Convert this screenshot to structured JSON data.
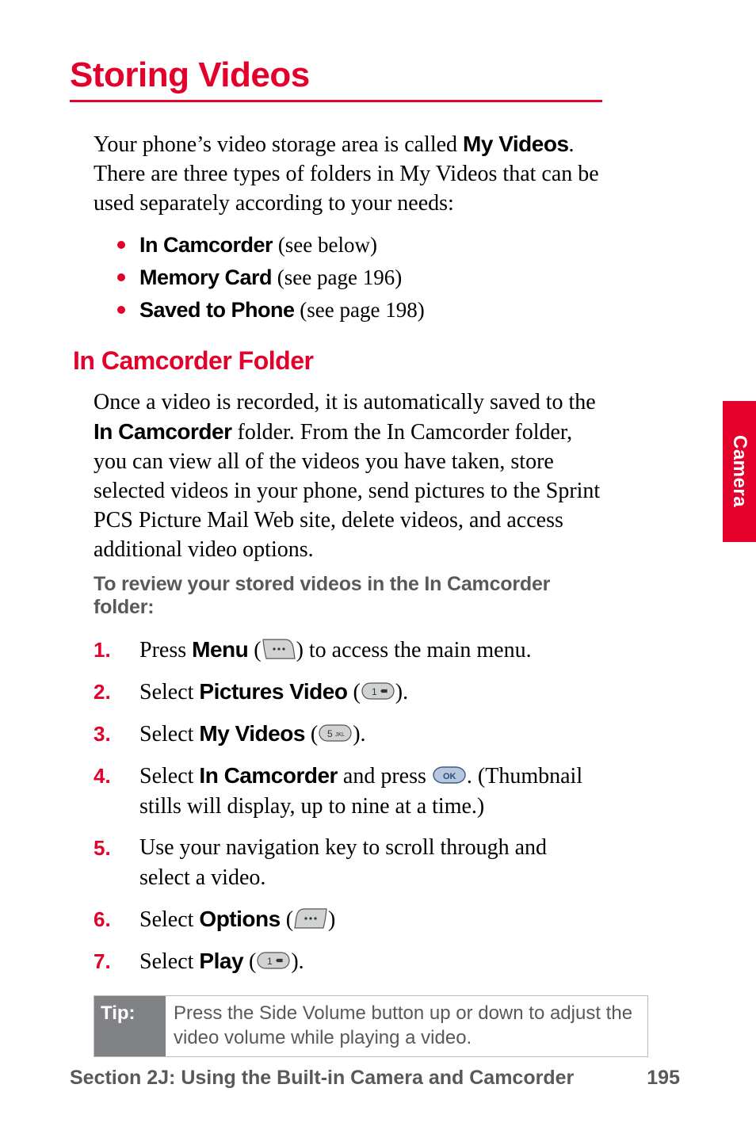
{
  "title": "Storing Videos",
  "intro": {
    "pre": "Your phone’s video storage area is called ",
    "bold": "My Videos",
    "post": ". There are three types of folders in My Videos that can be used separately according to your needs:"
  },
  "folders": [
    {
      "bold": "In  Camcorder",
      "rest": " (see below)"
    },
    {
      "bold": "Memory Card",
      "rest": " (see page 196)"
    },
    {
      "bold": "Saved to Phone",
      "rest": " (see page 198)"
    }
  ],
  "subheading": "In Camcorder Folder",
  "para": {
    "pre": "Once a video is recorded, it is automatically saved to the ",
    "bold": "In Camcorder",
    "post": " folder. From the In Camcorder folder, you can view all of the videos you have taken, store selected videos in your phone, send pictures to the Sprint PCS Picture Mail Web site, delete videos, and access additional video options."
  },
  "lead": "To review your stored videos in the In Camcorder folder:",
  "steps": {
    "s1": {
      "pre": "Press ",
      "bold": "Menu",
      "mid": " (",
      "icon": "softkey-right",
      "post": ") to access the main menu."
    },
    "s2": {
      "pre": "Select ",
      "bold": "Pictures Video",
      "mid": " (",
      "icon": "key-1",
      "post": ")."
    },
    "s3": {
      "pre": "Select ",
      "bold": "My Videos",
      "mid": " (",
      "icon": "key-5",
      "post": ")."
    },
    "s4": {
      "pre": "Select ",
      "bold": "In Camcorder",
      "mid": " and press ",
      "icon": "key-ok",
      "post": ". (Thumbnail stills will display, up to nine at a time.)"
    },
    "s5": {
      "text": "Use your navigation key to scroll through and select a video."
    },
    "s6": {
      "pre": "Select ",
      "bold": "Options",
      "mid": " (",
      "icon": "softkey-left",
      "post": ")"
    },
    "s7": {
      "pre": "Select ",
      "bold": "Play",
      "mid": " (",
      "icon": "key-1",
      "post": ")."
    }
  },
  "tip": {
    "label": "Tip:",
    "body": "Press the Side Volume button up or down to adjust the video volume while playing a video."
  },
  "footer": {
    "section": "Section 2J: Using the Built-in Camera and Camcorder",
    "page": "195"
  },
  "thumb": "Camera"
}
